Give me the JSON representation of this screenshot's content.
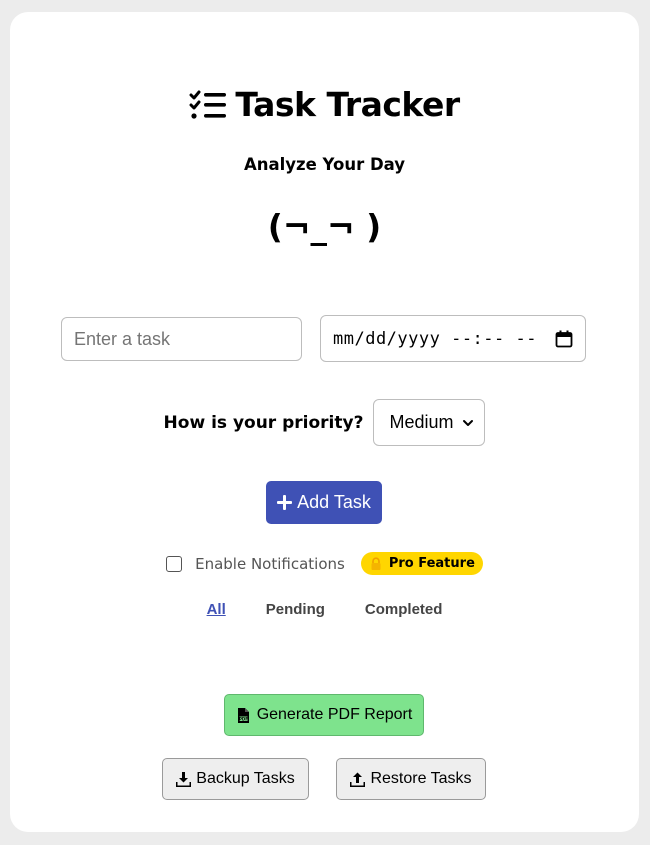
{
  "app": {
    "title": "Task Tracker",
    "title_icon": "checklist-icon",
    "subtitle": "Analyze Your Day",
    "mood_face": "(¬_¬ )"
  },
  "form": {
    "task_placeholder": "Enter a task",
    "task_value": "",
    "datetime_display": "mm/dd/yyyy --:-- --",
    "priority_label": "How is your priority?",
    "priority_selected": "Medium",
    "add_button_label": "Add Task"
  },
  "notifications": {
    "label": "Enable Notifications",
    "checked": false,
    "badge_label": "Pro Feature",
    "badge_icon": "lock-icon"
  },
  "filters": [
    {
      "label": "All",
      "active": true
    },
    {
      "label": "Pending",
      "active": false
    },
    {
      "label": "Completed",
      "active": false
    }
  ],
  "actions": {
    "pdf_label": "Generate PDF Report",
    "backup_label": "Backup Tasks",
    "restore_label": "Restore Tasks"
  },
  "colors": {
    "accent": "#3f51b5",
    "pdf_button": "#7ee38d",
    "pro_badge": "#ffd600",
    "background": "#ececec"
  }
}
